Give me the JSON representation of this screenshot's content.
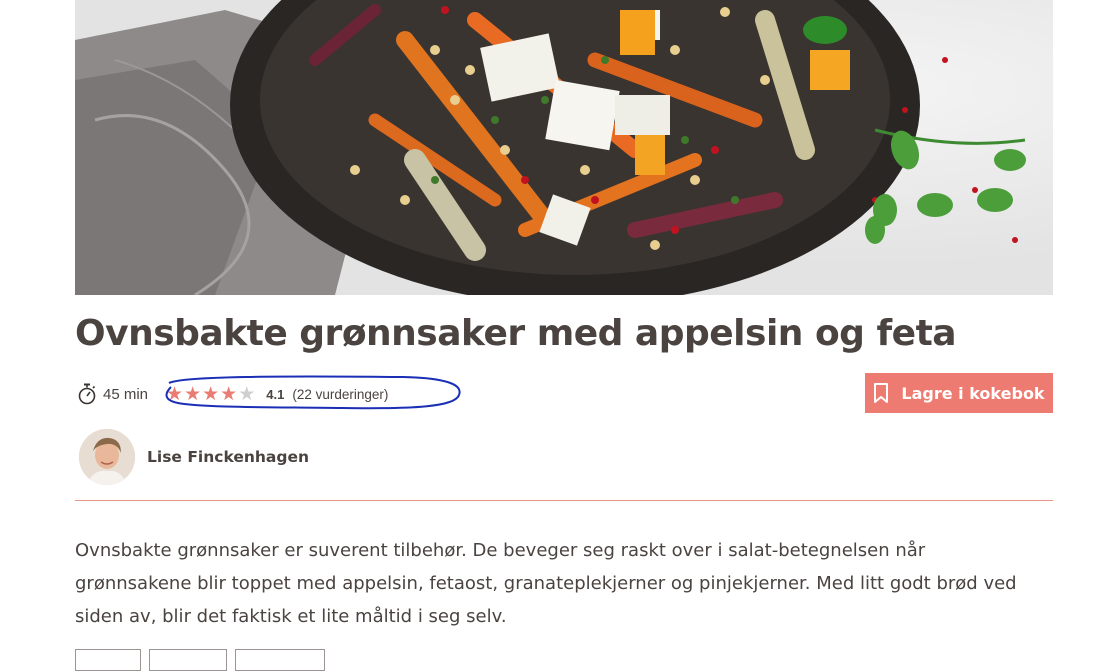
{
  "recipe": {
    "title": "Ovnsbakte grønnsaker med appelsin og feta",
    "time": "45 min",
    "rating": {
      "stars_filled": 4,
      "stars_total": 5,
      "score": "4.1",
      "count": "(22 vurderinger)"
    },
    "save_label": "Lagre i kokebok",
    "author": "Lise Finckenhagen",
    "intro": "Ovnsbakte grønnsaker er suverent tilbehør. De beveger seg raskt over i salat-betegnelsen når grønnsakene blir toppet med appelsin, fetaost, granateplekjerner og pinjekjerner. Med litt godt brød ved siden av, blir det faktisk et lite måltid i seg selv.",
    "tags": [
      "",
      "",
      ""
    ]
  },
  "icons": {
    "timer": "stopwatch-icon",
    "save": "bookmark-icon",
    "star": "star-icon"
  },
  "colors": {
    "accent": "#ee7b71",
    "star_on": "#e97d73",
    "star_off": "#cfcfcf",
    "text": "#4a4340",
    "annotation": "#1a2fb5"
  }
}
